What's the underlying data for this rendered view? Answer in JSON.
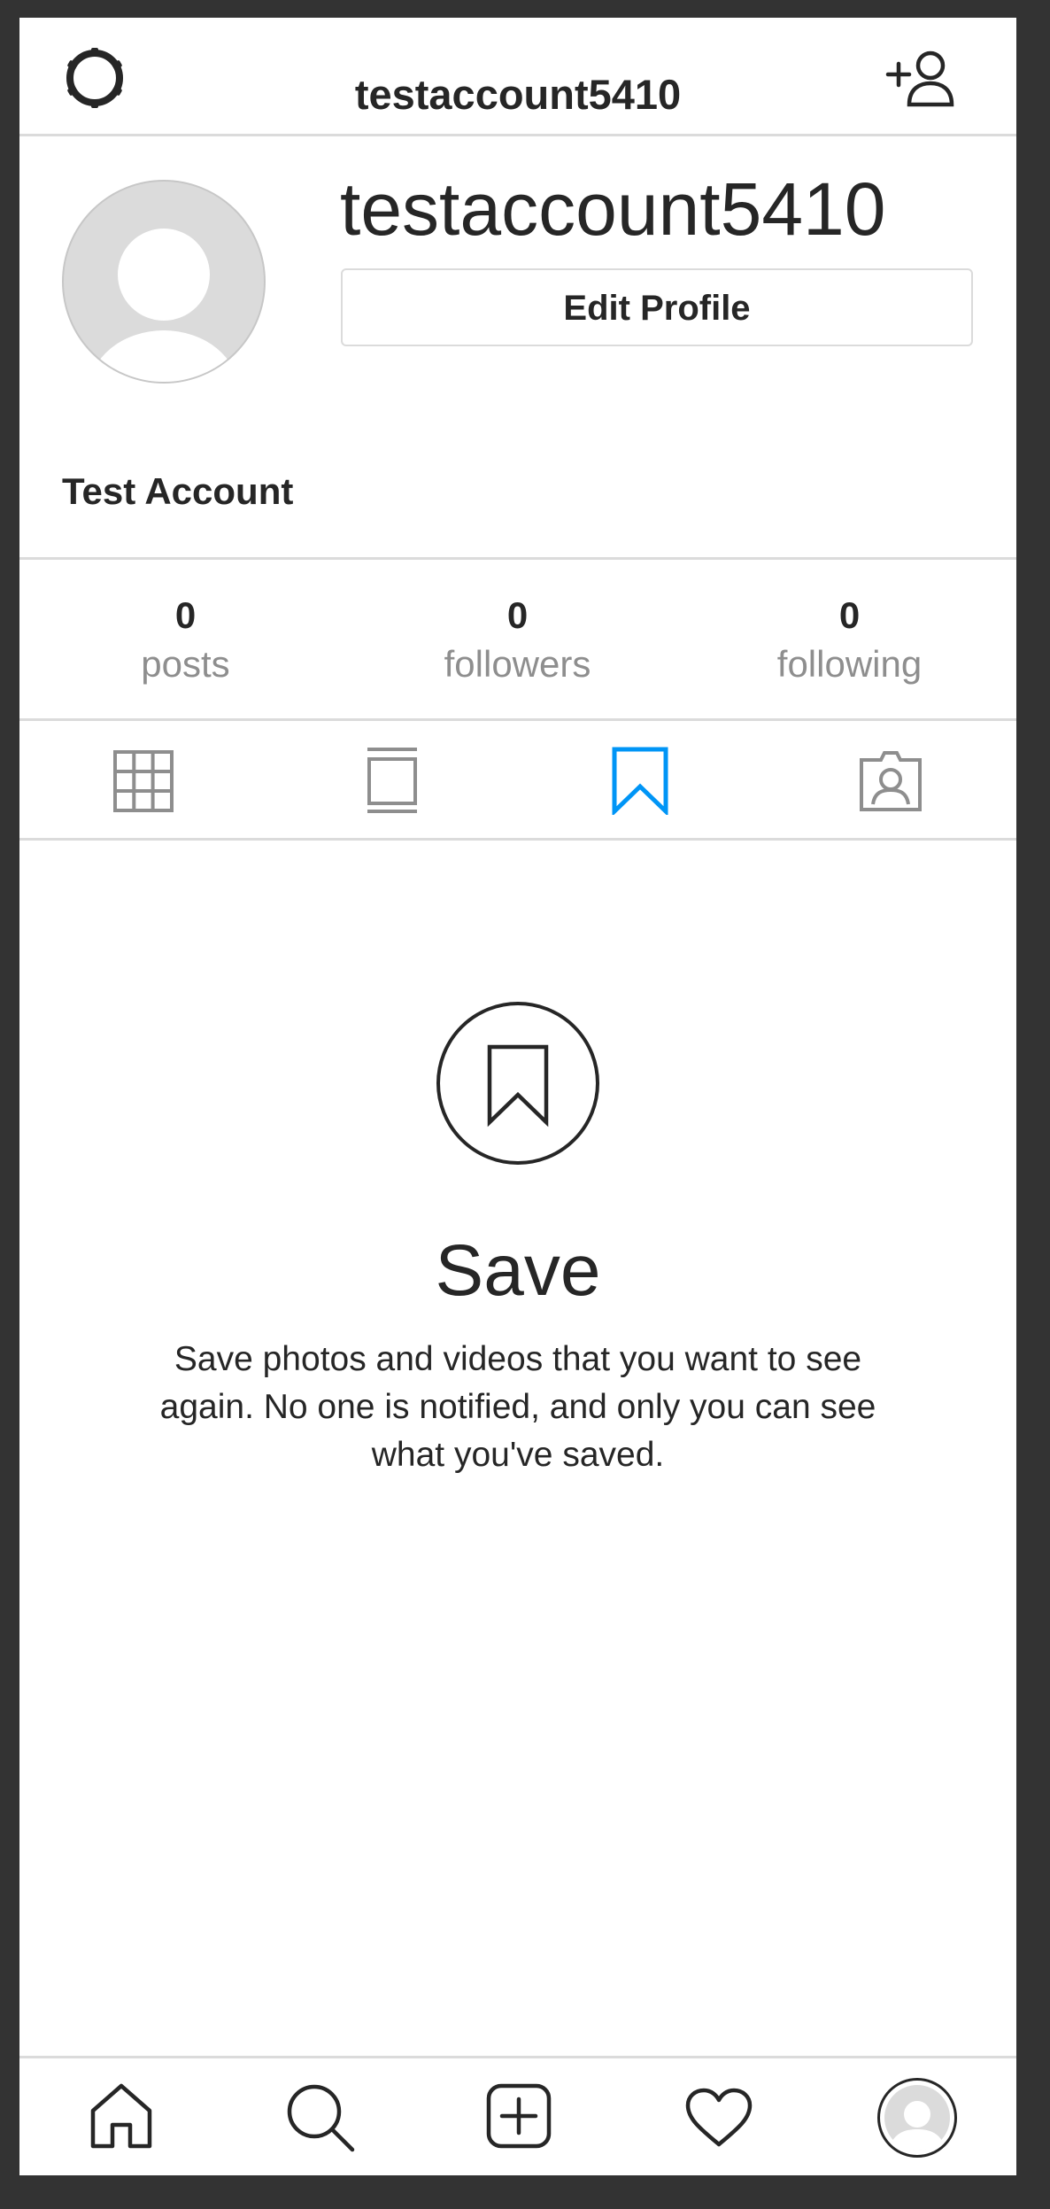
{
  "header": {
    "title": "testaccount5410",
    "settings_icon": "gear-icon",
    "add_person_icon": "add-person-icon"
  },
  "profile": {
    "username": "testaccount5410",
    "edit_button_label": "Edit Profile",
    "full_name": "Test Account"
  },
  "stats": [
    {
      "value": "0",
      "label": "posts"
    },
    {
      "value": "0",
      "label": "followers"
    },
    {
      "value": "0",
      "label": "following"
    }
  ],
  "tabs": [
    {
      "icon": "grid-icon",
      "active": false
    },
    {
      "icon": "feed-icon",
      "active": false
    },
    {
      "icon": "bookmark-icon",
      "active": true
    },
    {
      "icon": "tagged-icon",
      "active": false
    }
  ],
  "empty_state": {
    "icon": "bookmark-circle-icon",
    "title": "Save",
    "text": "Save photos and videos that you want to see again. No one is notified, and only you can see what you've saved."
  },
  "bottom_nav": [
    {
      "icon": "home-icon"
    },
    {
      "icon": "search-icon"
    },
    {
      "icon": "new-post-icon"
    },
    {
      "icon": "heart-icon"
    },
    {
      "icon": "profile-avatar"
    }
  ],
  "colors": {
    "accent": "#0095f6",
    "text": "#262626",
    "muted": "#8e8e8e",
    "divider": "#dbdbdb",
    "frame": "#333333"
  }
}
